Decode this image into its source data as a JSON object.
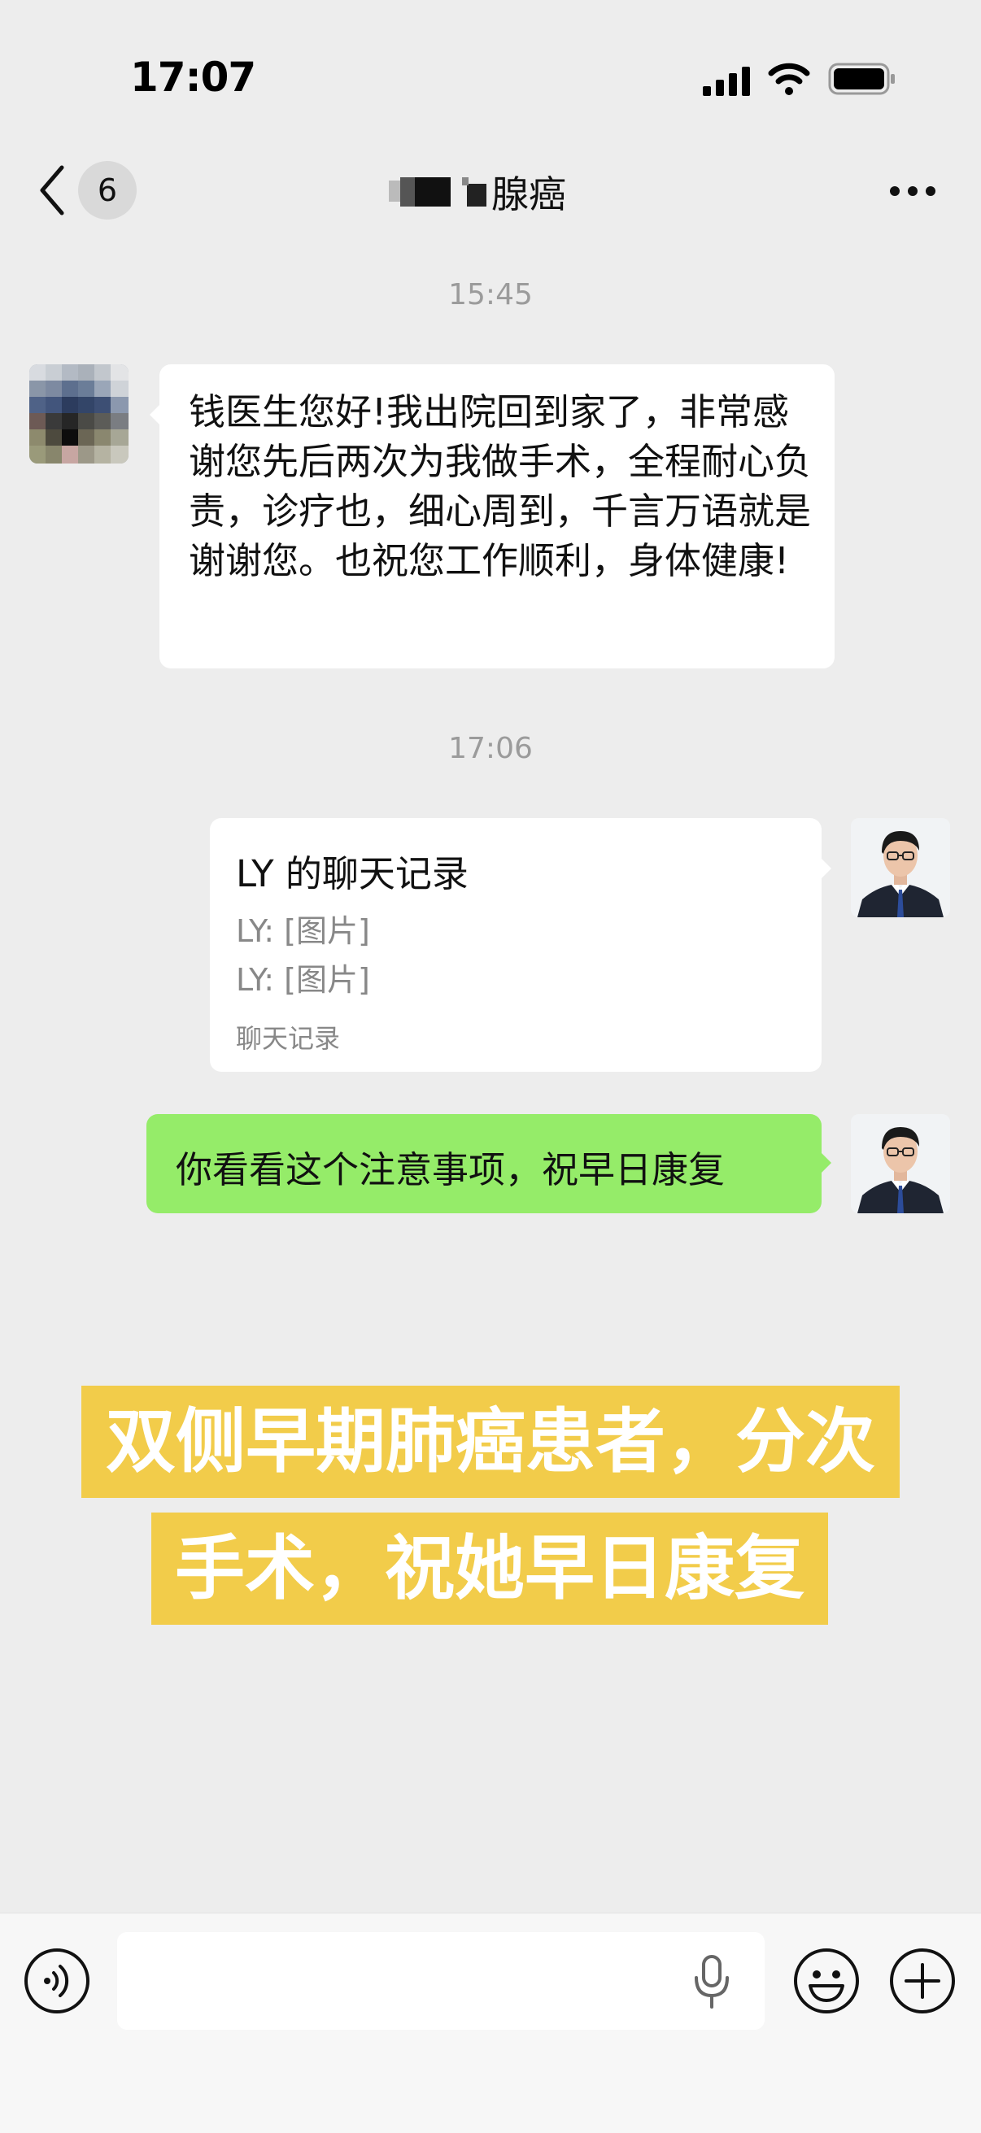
{
  "status_bar": {
    "time": "17:07"
  },
  "nav": {
    "unread_count": "6",
    "title": "腺癌"
  },
  "messages": [
    {
      "timestamp": "15:45",
      "text": "钱医生您好!我出院回到家了，非常感谢您先后两次为我做手术，全程耐心负责，诊疗也，细心周到，千言万语就是谢谢您。也祝您工作顺利，身体健康!"
    },
    {
      "timestamp": "17:06",
      "card": {
        "title": "LY 的聊天记录",
        "line1": "LY: [图片]",
        "line2": "LY: [图片]",
        "footer": "聊天记录"
      }
    },
    {
      "text": "你看看这个注意事项，祝早日康复"
    }
  ],
  "caption": {
    "line1": "双侧早期肺癌患者，分次",
    "line2": "手术，祝她早日康复"
  },
  "input": {
    "placeholder": ""
  },
  "colors": {
    "background": "#ededed",
    "my_bubble": "#95ec69",
    "caption_bg": "#f2cc4a"
  },
  "icons": [
    "signal-icon",
    "wifi-icon",
    "battery-icon",
    "back-chevron-icon",
    "more-icon",
    "voice-icon",
    "microphone-icon",
    "emoji-icon",
    "plus-icon"
  ]
}
